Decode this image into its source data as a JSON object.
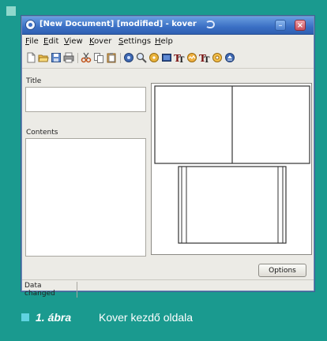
{
  "window": {
    "title": "[New Document] [modified] - kover",
    "minimize_symbol": "–",
    "close_symbol": "×"
  },
  "menubar": {
    "items": [
      "File",
      "Edit",
      "View",
      "Kover",
      "Settings",
      "Help"
    ]
  },
  "toolbar": {
    "icons": [
      "new-document-icon",
      "open-folder-icon",
      "save-icon",
      "print-icon",
      "cut-icon",
      "copy-icon",
      "paste-icon",
      "preview-icon",
      "zoom-icon",
      "cddb-icon",
      "image-icon",
      "title-font-icon",
      "image-embed-icon",
      "contents-font-icon",
      "cd-icon",
      "eject-icon"
    ]
  },
  "form": {
    "title_label": "Title",
    "title_value": "",
    "contents_label": "Contents",
    "contents_value": ""
  },
  "options_label": "Options",
  "status": {
    "text": "Data changed"
  },
  "caption": {
    "figure": "1. ábra",
    "text": "Kover kezdő oldala"
  },
  "colors": {
    "background": "#1a9a8f",
    "titlebar": "#3a6fc4",
    "window": "#ecebe6",
    "caption_square": "#5fd3e0"
  }
}
